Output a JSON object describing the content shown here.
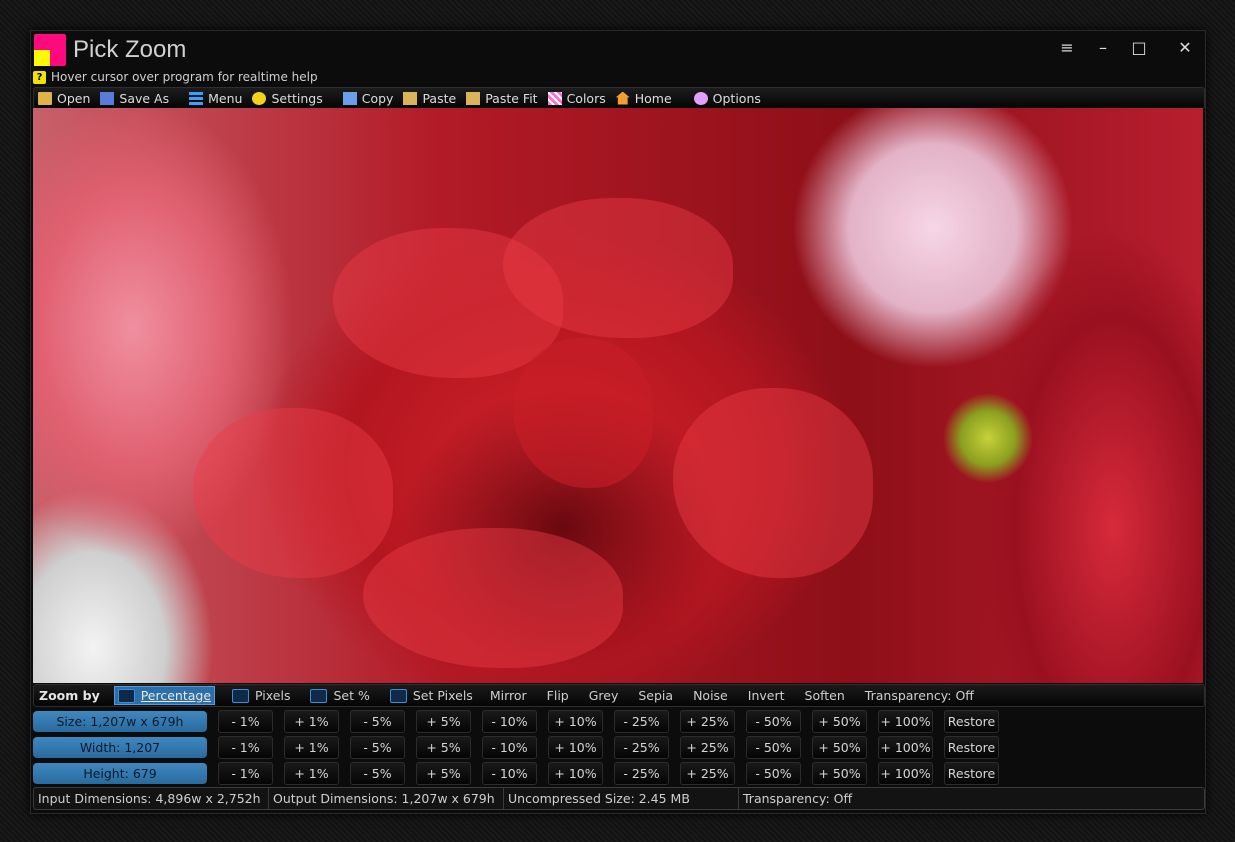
{
  "window": {
    "title": "Pick Zoom",
    "controls": {
      "menu": "≡",
      "minimize": "–",
      "maximize": "□",
      "close": "✕"
    }
  },
  "help": {
    "icon": "?",
    "text": "Hover cursor over program for realtime help"
  },
  "toolbar": {
    "open": "Open",
    "save_as": "Save As",
    "menu": "Menu",
    "settings": "Settings",
    "copy": "Copy",
    "paste": "Paste",
    "paste_fit": "Paste Fit",
    "colors": "Colors",
    "home": "Home",
    "options": "Options"
  },
  "zoom_bar": {
    "label": "Zoom by",
    "options": [
      "Percentage",
      "Pixels",
      "Set %",
      "Set Pixels"
    ],
    "selected": "Percentage",
    "actions": [
      "Mirror",
      "Flip",
      "Grey",
      "Sepia",
      "Noise",
      "Invert",
      "Soften",
      "Transparency: Off"
    ]
  },
  "resize_rows": [
    {
      "label": "Size: 1,207w x 679h",
      "buttons": [
        "- 1%",
        "+ 1%",
        "- 5%",
        "+ 5%",
        "- 10%",
        "+ 10%",
        "- 25%",
        "+ 25%",
        "- 50%",
        "+ 50%",
        "+ 100%",
        "Restore"
      ]
    },
    {
      "label": "Width: 1,207",
      "buttons": [
        "- 1%",
        "+ 1%",
        "- 5%",
        "+ 5%",
        "- 10%",
        "+ 10%",
        "- 25%",
        "+ 25%",
        "- 50%",
        "+ 50%",
        "+ 100%",
        "Restore"
      ]
    },
    {
      "label": "Height: 679",
      "buttons": [
        "- 1%",
        "+ 1%",
        "- 5%",
        "+ 5%",
        "- 10%",
        "+ 10%",
        "- 25%",
        "+ 25%",
        "- 50%",
        "+ 50%",
        "+ 100%",
        "Restore"
      ]
    }
  ],
  "status": {
    "input": "Input Dimensions: 4,896w x 2,752h",
    "output": "Output Dimensions: 1,207w x 679h",
    "uncompressed": "Uncompressed Size: 2.45 MB",
    "transparency": "Transparency: Off"
  },
  "colors": {
    "accent_blue": "#2b6ea8",
    "logo_pink": "#ff0a7c",
    "logo_yellow": "#fffa00"
  }
}
